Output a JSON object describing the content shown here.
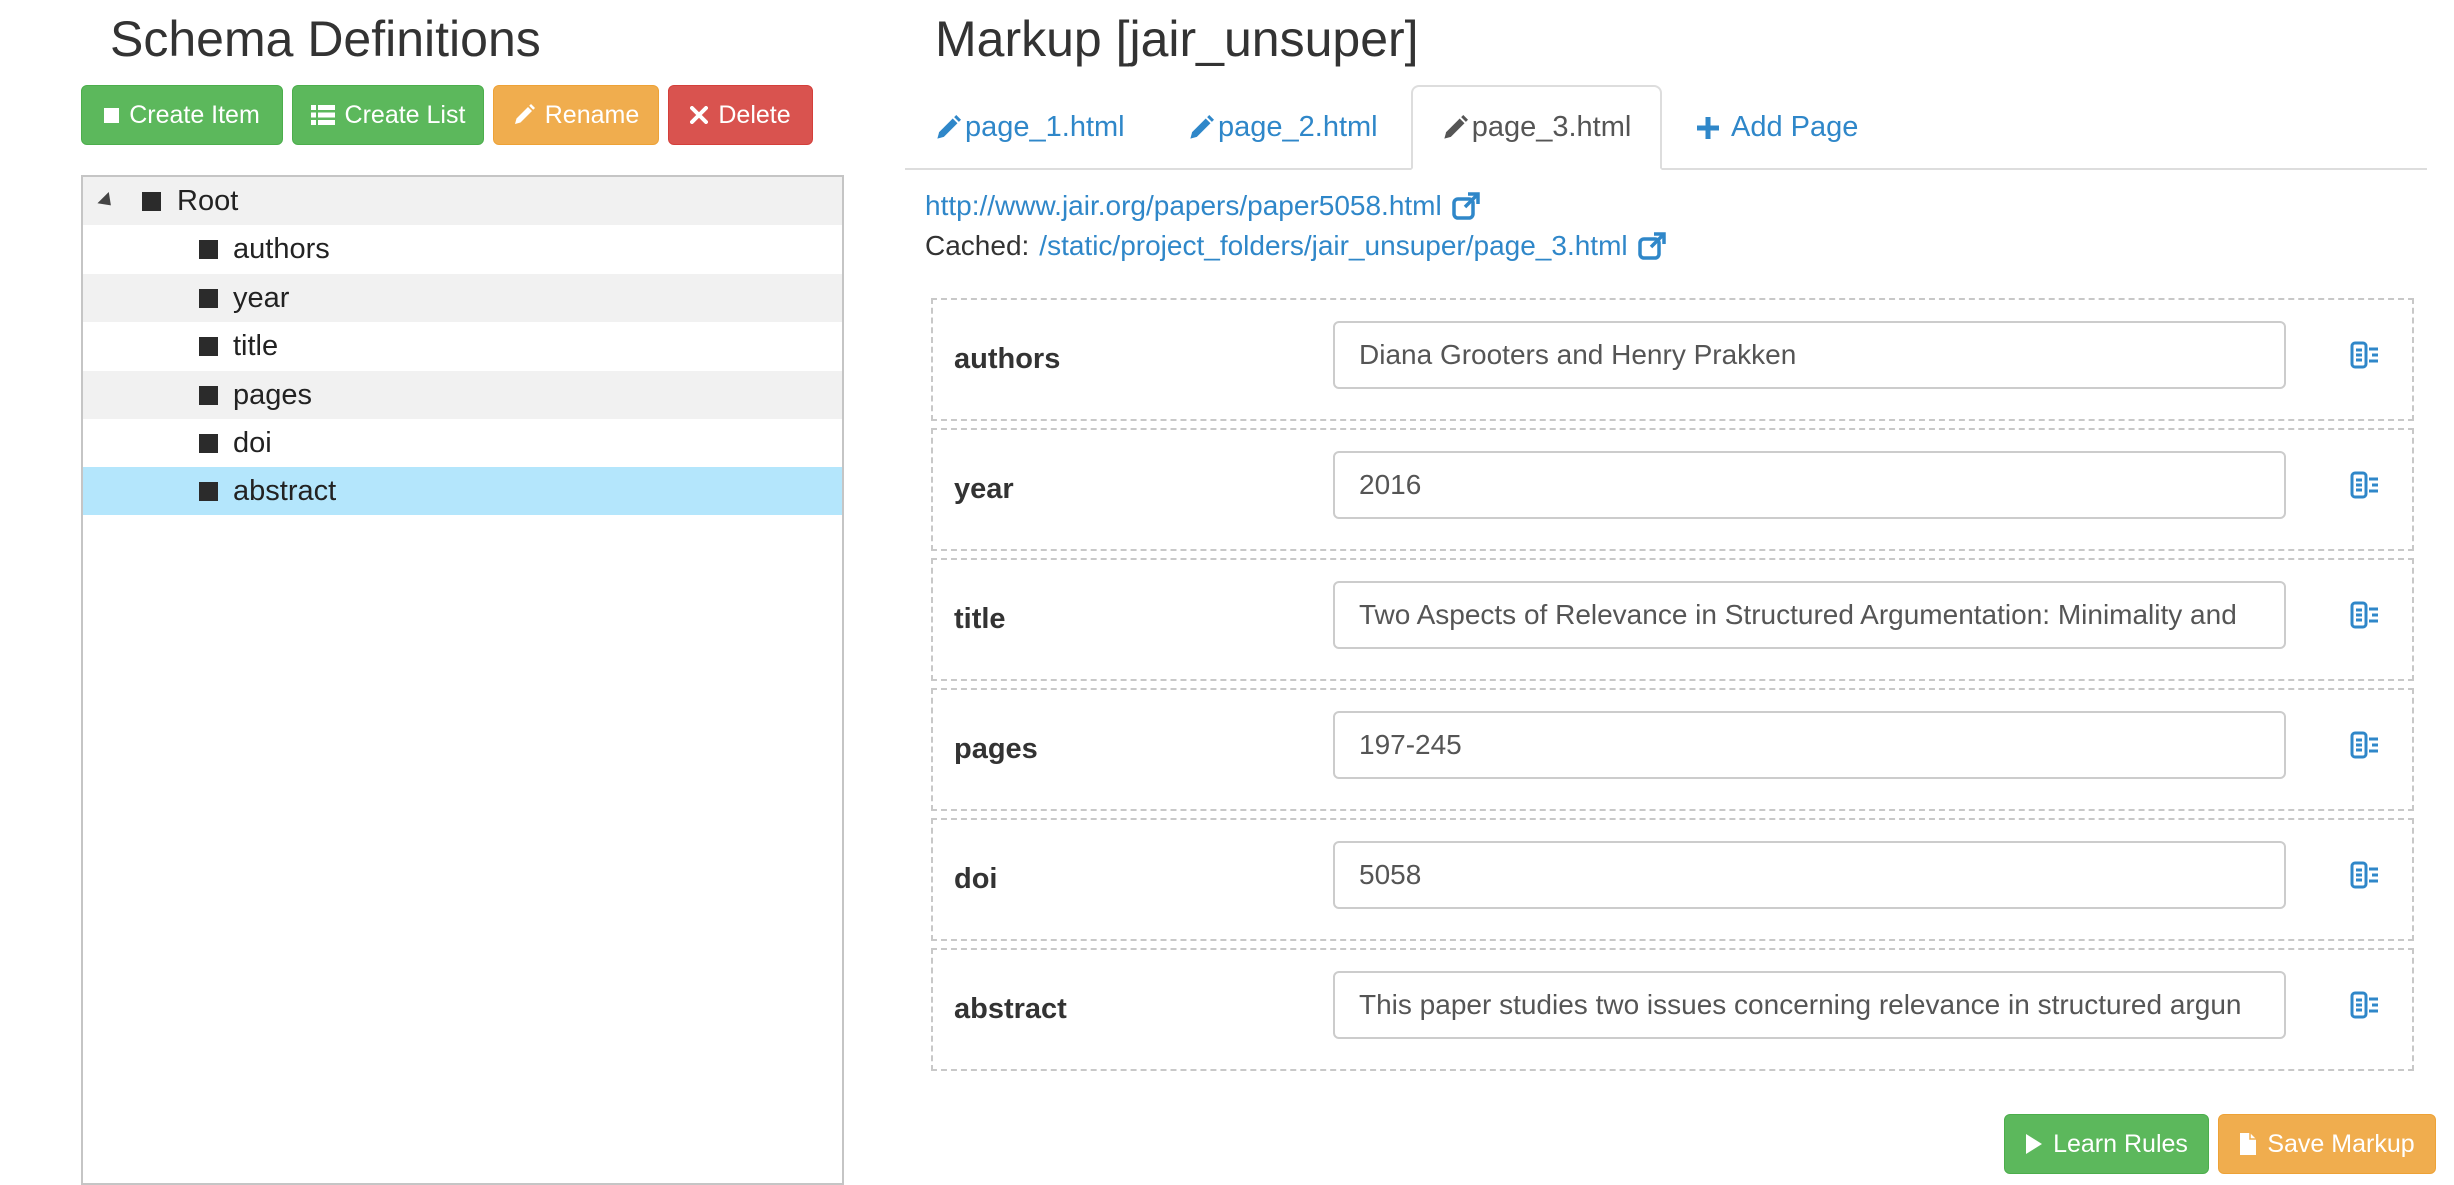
{
  "schema": {
    "heading": "Schema Definitions",
    "buttons": {
      "create_item": "Create Item",
      "create_list": "Create List",
      "rename": "Rename",
      "delete": "Delete"
    },
    "tree": {
      "root": "Root",
      "items": [
        "authors",
        "year",
        "title",
        "pages",
        "doi",
        "abstract"
      ],
      "selected": "abstract"
    }
  },
  "markup": {
    "heading": "Markup [jair_unsuper]",
    "tabs": [
      "page_1.html",
      "page_2.html",
      "page_3.html"
    ],
    "active_tab": "page_3.html",
    "add_page": "Add Page",
    "url": "http://www.jair.org/papers/paper5058.html",
    "cached_label": "Cached:",
    "cached_url": "/static/project_folders/jair_unsuper/page_3.html",
    "fields": [
      {
        "label": "authors",
        "value": "Diana Grooters and Henry Prakken"
      },
      {
        "label": "year",
        "value": "2016"
      },
      {
        "label": "title",
        "value": "Two Aspects of Relevance in Structured Argumentation: Minimality and"
      },
      {
        "label": "pages",
        "value": "197-245"
      },
      {
        "label": "doi",
        "value": "5058"
      },
      {
        "label": "abstract",
        "value": "This paper studies two issues concerning relevance in structured argun"
      }
    ],
    "learn_rules": "Learn Rules",
    "save_markup": "Save Markup"
  },
  "colors": {
    "link": "#2f87c9",
    "success": "#5cb85c",
    "warning": "#f0ad4e",
    "danger": "#d9534f",
    "selected_row": "#b4e6fc"
  },
  "icons": {
    "create_item": "square-icon",
    "create_list": "list-icon",
    "rename": "pencil-icon",
    "delete": "close-icon",
    "tab": "pencil-icon",
    "add_page": "plus-icon",
    "external_link": "external-link-icon",
    "field_action": "selector-icon",
    "learn_rules": "play-icon",
    "save_markup": "file-icon"
  }
}
